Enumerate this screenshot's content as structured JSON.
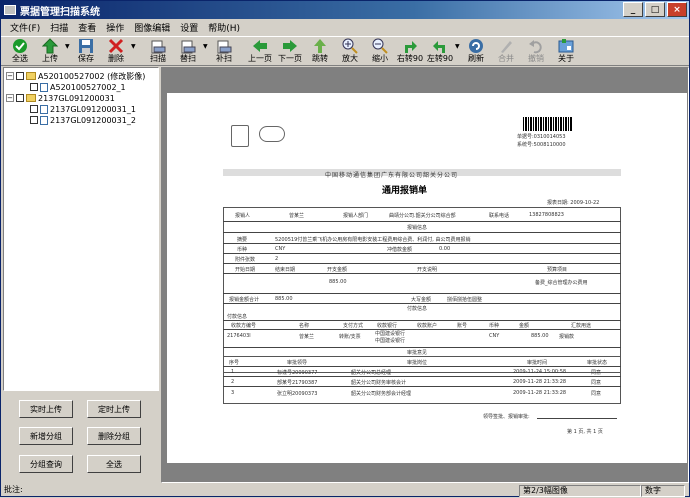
{
  "window": {
    "title": "票据管理扫描系统"
  },
  "menu": [
    "文件(F)",
    "扫描",
    "查看",
    "操作",
    "图像编辑",
    "设置",
    "帮助(H)"
  ],
  "toolbar": {
    "select_all": "全选",
    "upload": "上传",
    "save": "保存",
    "delete": "删除",
    "scan": "扫描",
    "replace_scan": "替扫",
    "supplement_scan": "补扫",
    "prev_page": "上一页",
    "next_page": "下一页",
    "jump": "跳转",
    "zoom_in": "放大",
    "zoom_out": "缩小",
    "rotate_right": "右转90",
    "rotate_left": "左转90",
    "refresh": "刷新",
    "merge": "合并",
    "undo": "撤销",
    "about": "关于"
  },
  "tree": {
    "group1": "A520100527002 (修改影像)",
    "group1_child": "A520100527002_1",
    "group2": "2137GL091200031",
    "group2_children": [
      "2137GL091200031_1",
      "2137GL091200031_2"
    ]
  },
  "side_buttons": {
    "realtime_upload": "实时上传",
    "scheduled_upload": "定时上传",
    "add_group": "新增分组",
    "delete_group": "删除分组",
    "group_query": "分组查询",
    "select_all": "全选"
  },
  "document": {
    "company": "中国移动通信集团广东有限公司韶关分公司",
    "form_title": "通用报销单",
    "doc_no": "单据号:0310014053",
    "sys_no": "系统号:5008110000",
    "date": "报表日期: 2009-10-22",
    "applicant_label": "报销人",
    "applicant": "曾某兰",
    "dept_label": "报销人部门",
    "dept": "曲靖分公司.韶关分公司综合部",
    "phone_label": "联系电话",
    "phone": "13827808823",
    "section_info": "报销信息",
    "summary_label": "摘要",
    "summary": "5200519付曾兰乘飞机办公用房有限电影安装工程费用综合费、利润付, 由公司费用报销",
    "currency_label": "币种",
    "currency": "CNY",
    "amount_label": "冲借款金额",
    "amount_zero": "0.00",
    "attach_label": "附件张数",
    "attach": "2",
    "col_date": "开始日期",
    "col_end": "结束日期",
    "col_actual": "开支金额",
    "col_desc": "开支说明",
    "col_budget": "预算项目",
    "row_amount": "885.00",
    "row_budget": "备费_综合管理办公费用",
    "total_label": "报销金额合计",
    "total": "885.00",
    "capital_label": "大写金额",
    "capital": "捌佰捌拾伍圆整",
    "section_payment": "付款信息",
    "pay_info": "付款信息",
    "pay_cols": [
      "收款方编号",
      "名称",
      "支付方式",
      "收款银行",
      "收款账户",
      "账号",
      "币种",
      "金额",
      "汇款用途"
    ],
    "pay_row": [
      "2176403l",
      "曾某兰",
      "转账/支票",
      "中国建设银行 中国建设银行",
      "",
      "",
      "CNY",
      "885.00",
      "报销款"
    ],
    "section_approval": "审批意见",
    "approval_cols": [
      "序号",
      "审批领导",
      "审批岗位",
      "审批时间",
      "审批状态"
    ],
    "approvals": [
      [
        "1",
        "标谨号20090377",
        "韶关分公司总经理",
        "2009-11-24 15:00:58",
        "同意"
      ],
      [
        "2",
        "部某号21790387",
        "韶关分公司财务审核会计",
        "2009-11-28 21:33:28",
        "同意"
      ],
      [
        "3",
        "张立明20090373",
        "韶关分公司财务部会计经理",
        "2009-11-28 21:33:28",
        "同意"
      ]
    ],
    "footer_sign": "领导签批、报销审批:",
    "page_no": "第 1 页, 共 1 页"
  },
  "status": {
    "label": "批注:",
    "image_count": "第2/3幅图像",
    "mode": "数字"
  }
}
